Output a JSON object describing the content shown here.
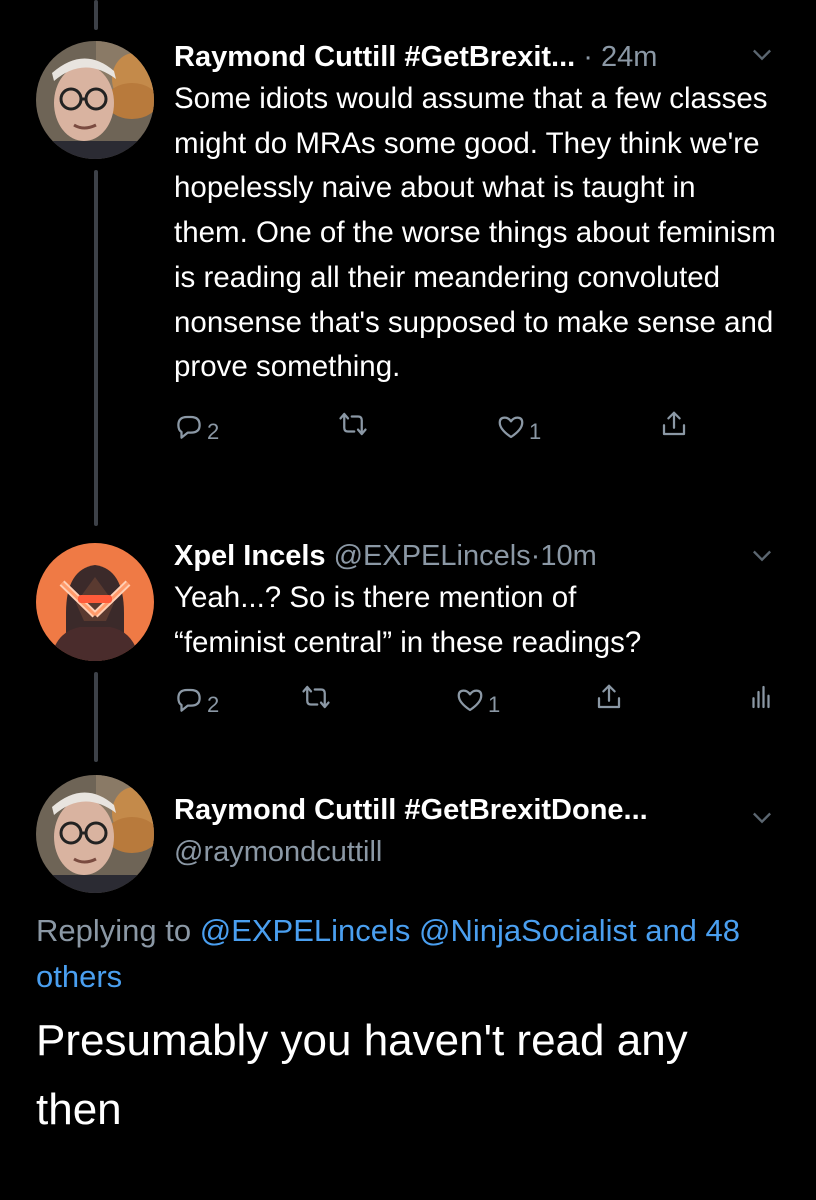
{
  "tweets": [
    {
      "name": "Raymond Cuttill #GetBrexit...",
      "time": "24m",
      "text": "Some idiots would assume that a few classes might do MRAs some good. They think we're hopelessly naive about what is taught in them. One of the worse things about feminism is reading all their meandering convoluted nonsense that's supposed to make sense and prove something.",
      "replies": "2",
      "likes": "1"
    },
    {
      "name": "Xpel Incels",
      "handle": "@EXPELincels",
      "time": "10m",
      "text_line1": "Yeah...? So is there mention of",
      "text_line2": "“feminist central” in these readings?",
      "replies": "2",
      "likes": "1"
    }
  ],
  "focus": {
    "name": "Raymond Cuttill #GetBrexitDone...",
    "handle": "@raymondcuttill",
    "replying_label": "Replying to",
    "mention1": "@EXPELincels",
    "mention2": "@NinjaSocialist",
    "and_others": "and 48 others",
    "text": "Presumably you haven't read any then"
  },
  "icons": [
    "reply-icon",
    "retweet-icon",
    "like-icon",
    "share-icon",
    "analytics-icon",
    "chevron-down-icon"
  ],
  "colors": {
    "background": "#000000",
    "muted": "#8b98a5",
    "link": "#4a9ff0"
  }
}
